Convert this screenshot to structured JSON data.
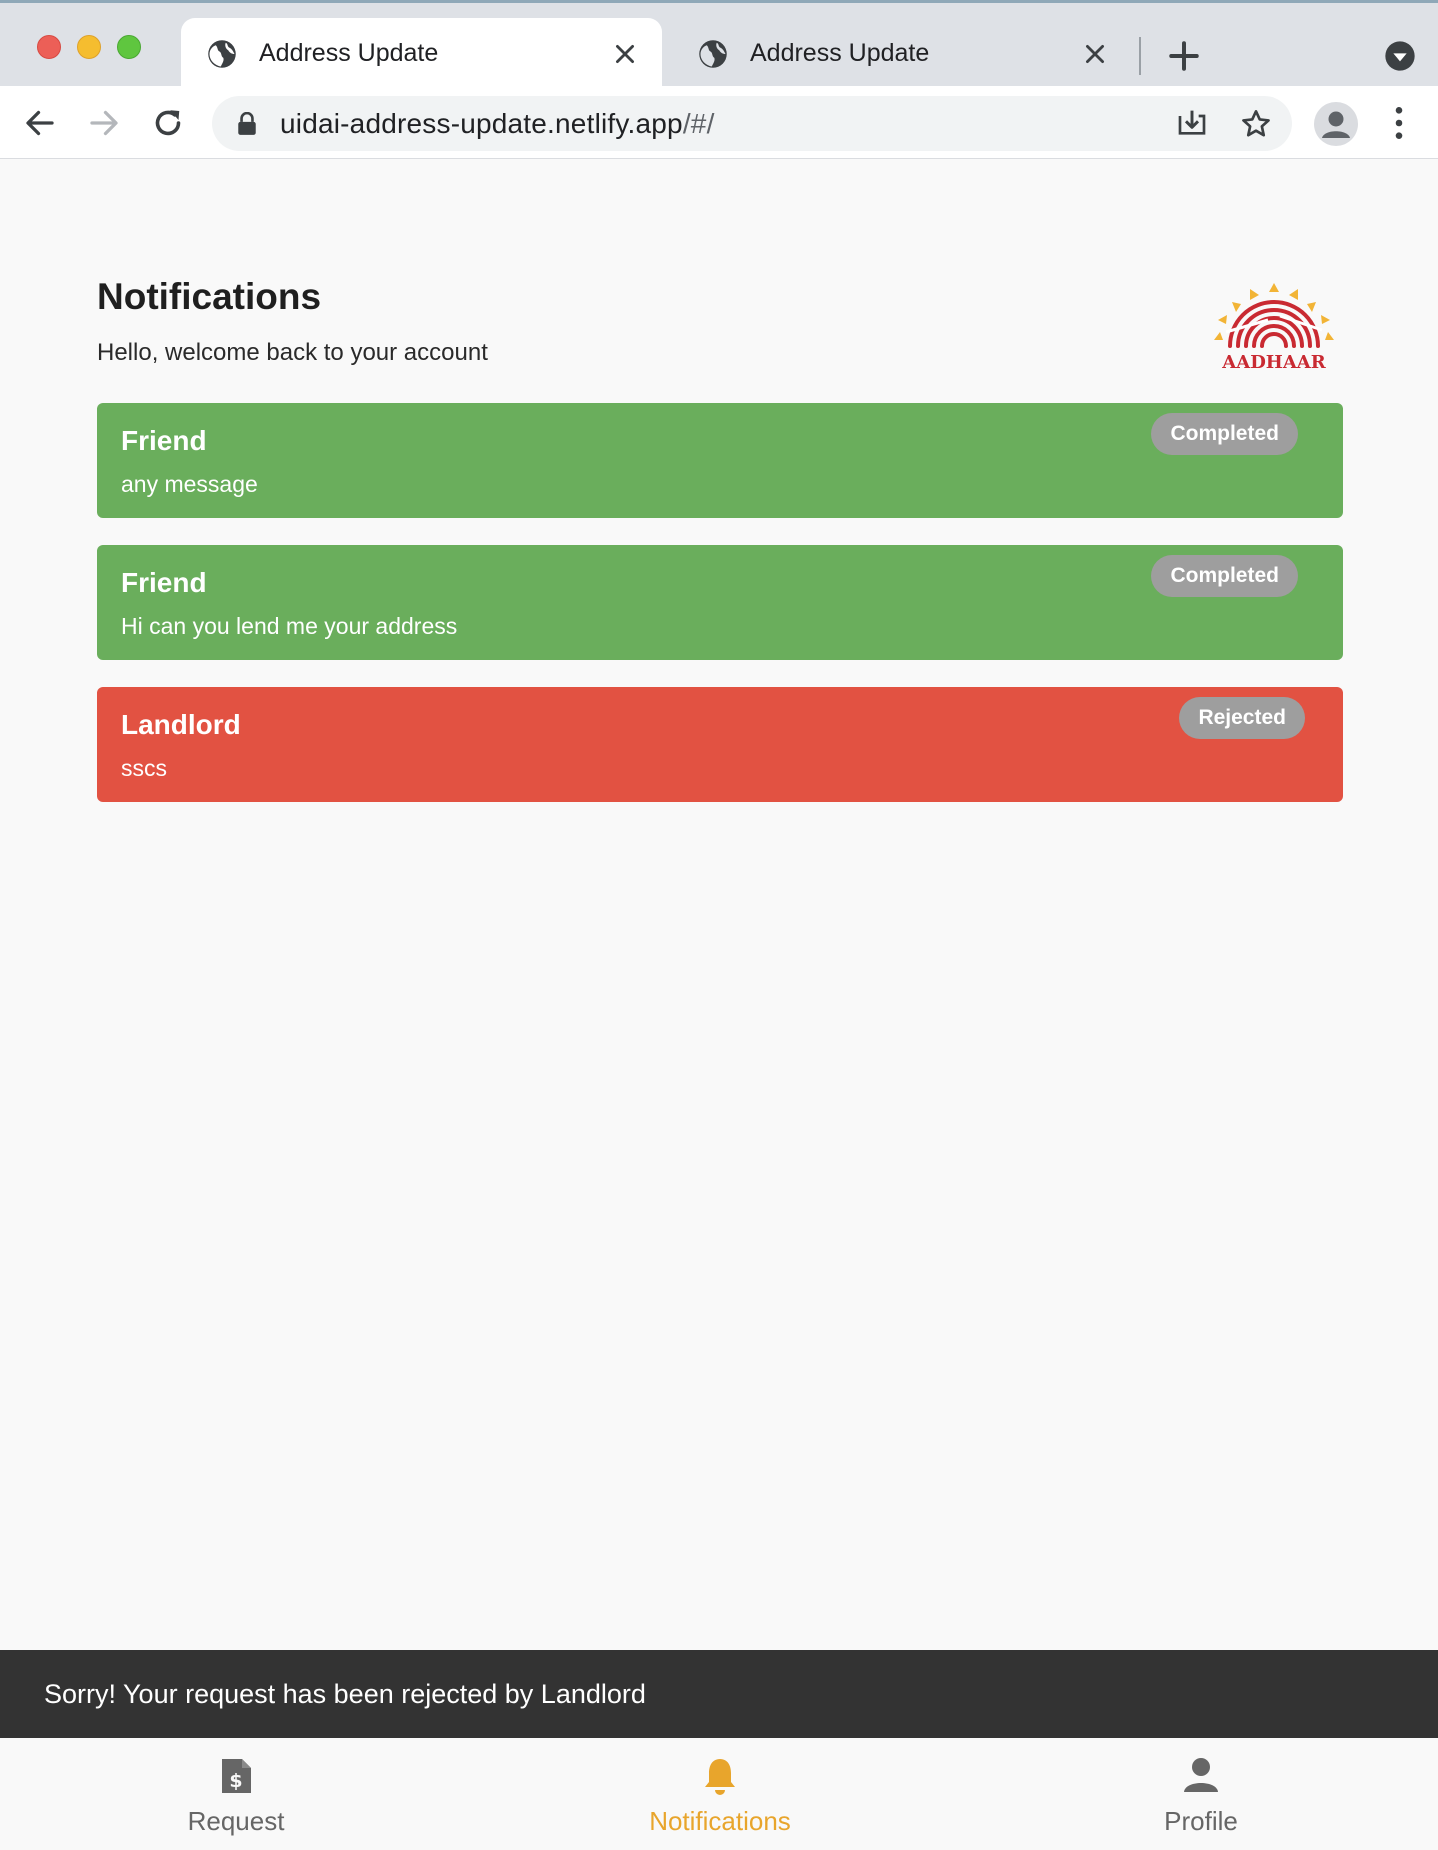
{
  "browser": {
    "tabs": [
      {
        "title": "Address Update",
        "active": true
      },
      {
        "title": "Address Update",
        "active": false
      }
    ],
    "url_main": "uidai-address-update.netlify.app",
    "url_path": "/#/"
  },
  "page": {
    "title": "Notifications",
    "subtitle": "Hello, welcome back to your account",
    "logo_text": "AADHAAR"
  },
  "notifications": [
    {
      "title": "Friend",
      "message": "any message",
      "status": "Completed",
      "color": "#6aae5c"
    },
    {
      "title": "Friend",
      "message": "Hi can you lend me your address",
      "status": "Completed",
      "color": "#6aae5c"
    },
    {
      "title": "Landlord",
      "message": "sscs",
      "status": "Rejected",
      "color": "#e25242"
    }
  ],
  "snackbar": {
    "text": "Sorry! Your request has been rejected by Landlord"
  },
  "bottom_nav": {
    "items": [
      {
        "label": "Request",
        "icon": "receipt-icon",
        "active": false
      },
      {
        "label": "Notifications",
        "icon": "bell-icon",
        "active": true
      },
      {
        "label": "Profile",
        "icon": "person-icon",
        "active": false
      }
    ],
    "active_color": "#e8a52c"
  }
}
